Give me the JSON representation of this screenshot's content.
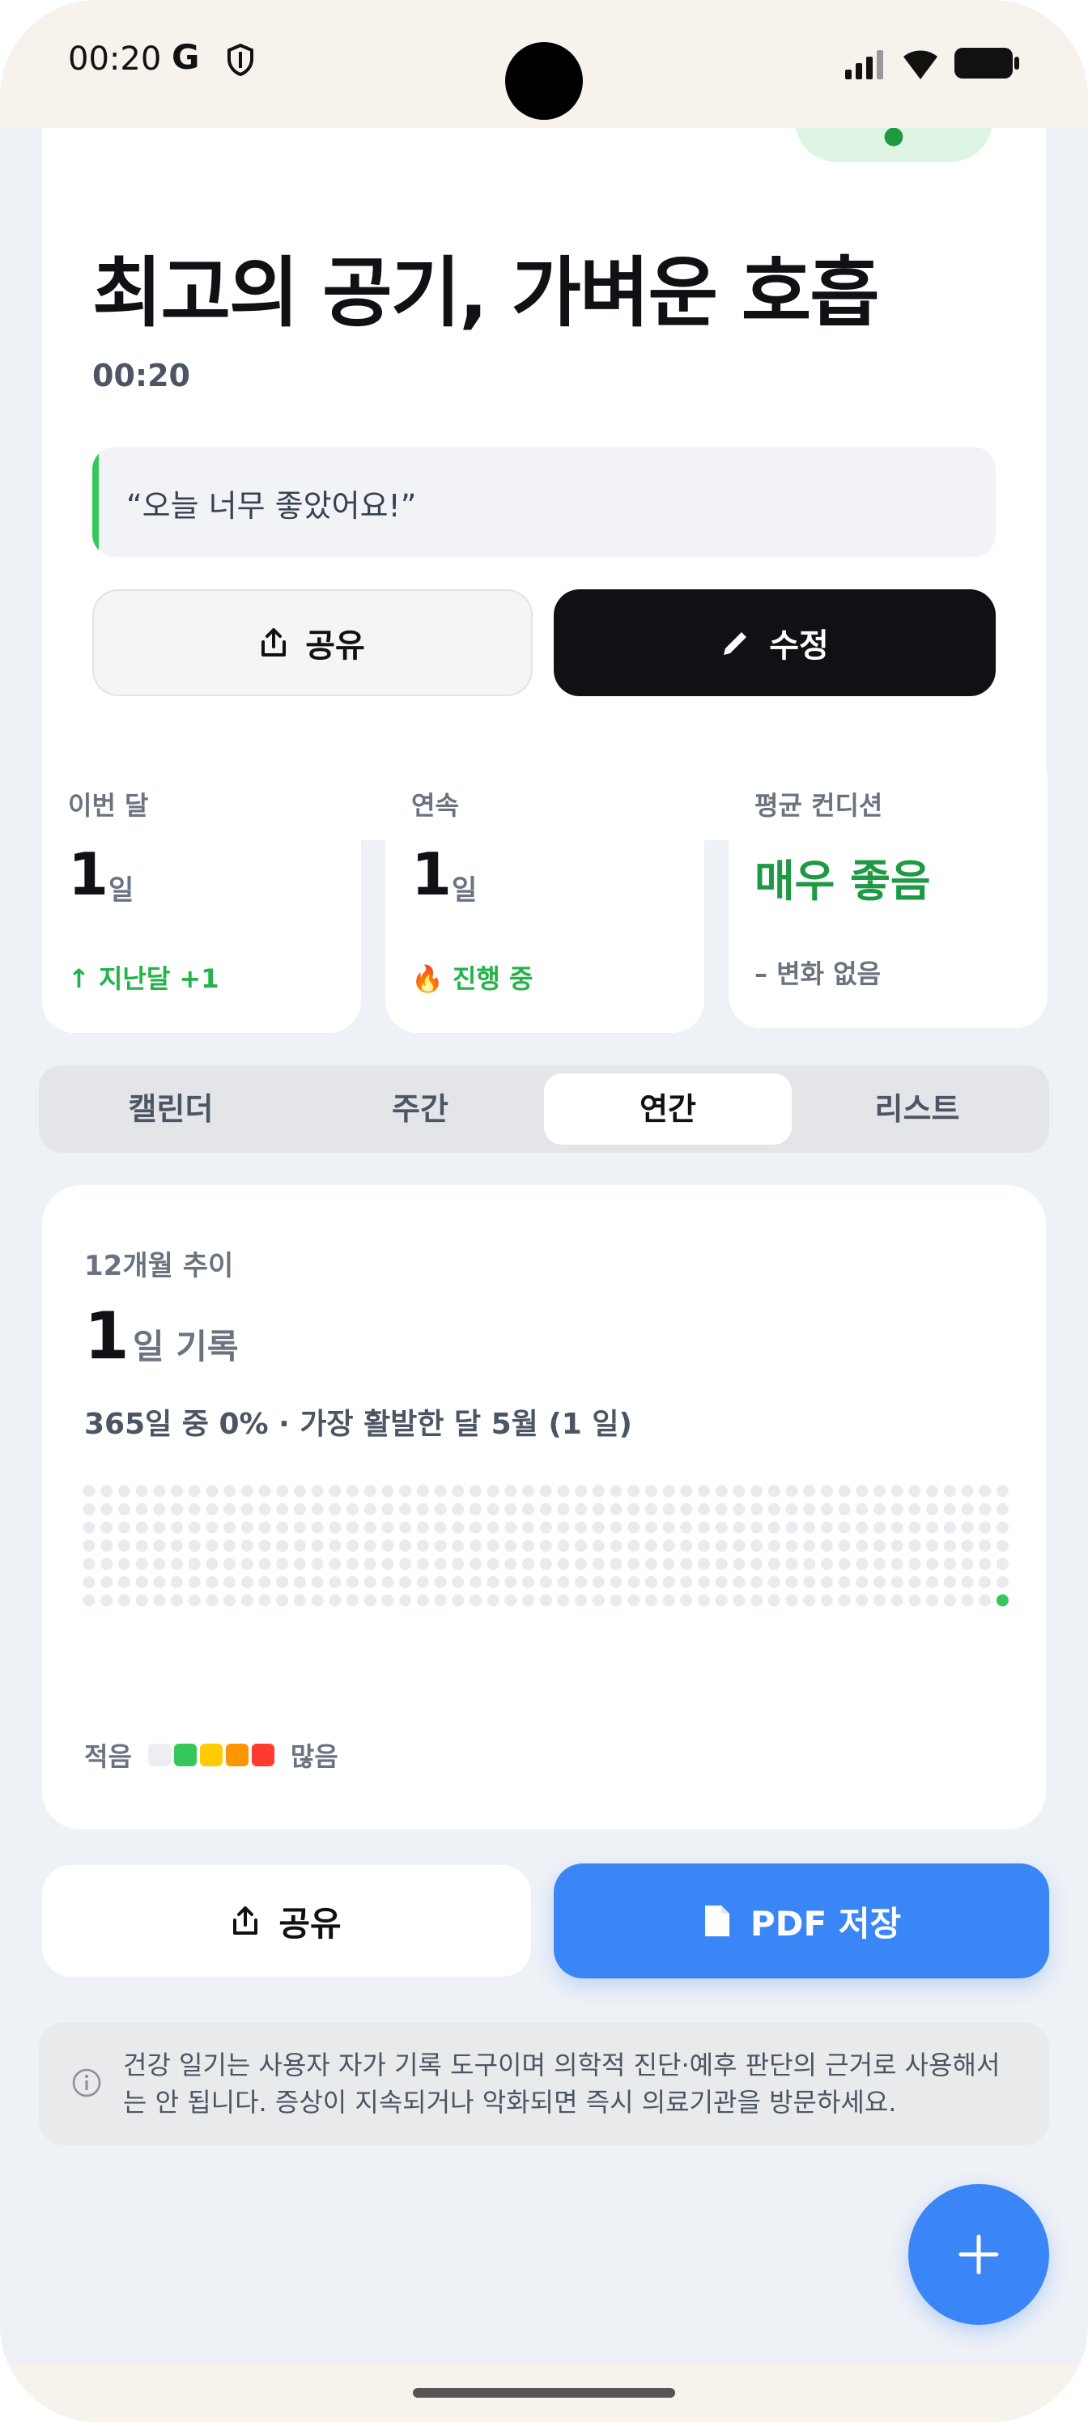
{
  "status_bar": {
    "time": "00:20",
    "google_glyph": "G",
    "icons": [
      "shield-icon",
      "signal-icon",
      "wifi-icon",
      "battery-icon"
    ]
  },
  "hero": {
    "title": "최고의 공기, 가벼운 호흡",
    "time": "00:20",
    "quote": "“오늘 너무 좋았어요!”",
    "share_label": "공유",
    "edit_label": "수정",
    "accent_color": "#34c759"
  },
  "stats": [
    {
      "label": "이번 달",
      "value": "1",
      "unit": "일",
      "foot": "↑ 지난달 +1",
      "foot_color": "#22b34a"
    },
    {
      "label": "연속",
      "value": "1",
      "unit": "일",
      "foot_emoji": "🔥",
      "foot": "진행 중",
      "foot_color": "#22b34a"
    },
    {
      "label": "평균 컨디션",
      "value": "매우 좋음",
      "foot": "– 변화 없음",
      "foot_color": "#6b7280"
    }
  ],
  "tabs": [
    {
      "label": "캘린더",
      "active": false
    },
    {
      "label": "주간",
      "active": false
    },
    {
      "label": "연간",
      "active": true
    },
    {
      "label": "리스트",
      "active": false
    }
  ],
  "yearly": {
    "label": "12개월 추이",
    "value": "1",
    "unit": "일 기록",
    "summary": "365일 중 0% · 가장 활발한 달 5월 (1 일)",
    "legend_less": "적음",
    "legend_more": "많음",
    "legend_colors": [
      "#eceef1",
      "#34c759",
      "#ffcc00",
      "#ff9500",
      "#ff3b30"
    ],
    "heatmap_filled_color": "#34c759",
    "heatmap_empty_color": "#e9ebef"
  },
  "actions": {
    "share_label": "공유",
    "pdf_label": "PDF 저장"
  },
  "disclaimer": "건강 일기는 사용자 자가 기록 도구이며 의학적 진단·예후 판단의 근거로 사용해서는 안 됩니다. 증상이 지속되거나 악화되면 즉시 의료기관을 방문하세요.",
  "fab_icon": "plus-icon"
}
